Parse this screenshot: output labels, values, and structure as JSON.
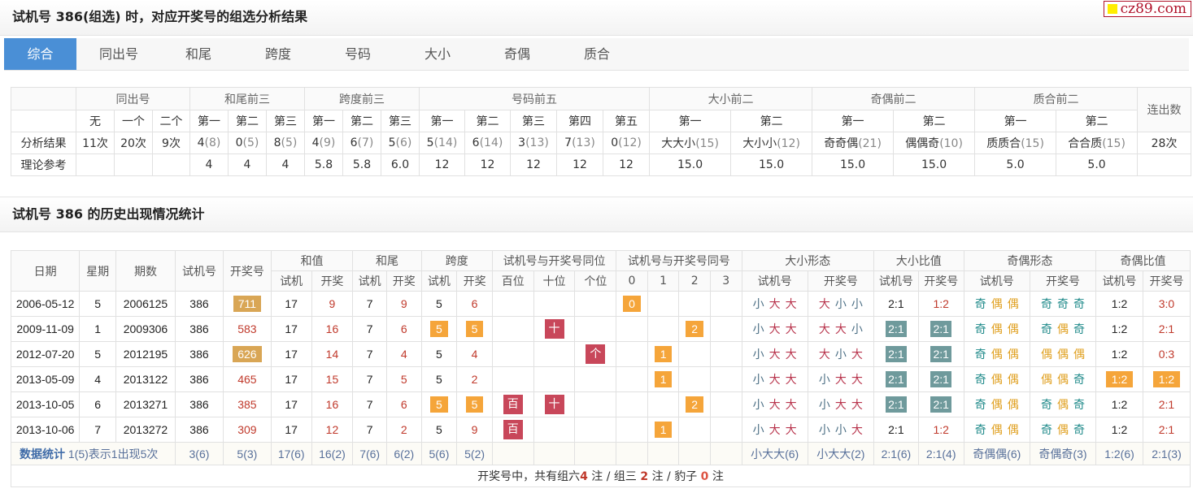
{
  "header": {
    "title": "试机号 386(组选) 时，对应开奖号的组选分析结果",
    "logo_text": "cz89.com"
  },
  "tabs": [
    {
      "label": "综合",
      "active": true
    },
    {
      "label": "同出号"
    },
    {
      "label": "和尾"
    },
    {
      "label": "跨度"
    },
    {
      "label": "号码"
    },
    {
      "label": "大小"
    },
    {
      "label": "奇偶"
    },
    {
      "label": "质合"
    }
  ],
  "analysis": {
    "groups": [
      "同出号",
      "和尾前三",
      "跨度前三",
      "号码前五",
      "大小前二",
      "奇偶前二",
      "质合前二",
      "连出数"
    ],
    "sub_tongchu": [
      "无",
      "一个",
      "二个"
    ],
    "sub_ordinals": [
      "第一",
      "第二",
      "第三",
      "第四",
      "第五"
    ],
    "row_labels": [
      "分析结果",
      "理论参考"
    ],
    "result": {
      "tongchu": [
        "11次",
        "20次",
        "9次"
      ],
      "hewei": [
        {
          "v": "4",
          "c": "(8)"
        },
        {
          "v": "0",
          "c": "(5)"
        },
        {
          "v": "8",
          "c": "(5)"
        }
      ],
      "kuadu": [
        {
          "v": "4",
          "c": "(9)"
        },
        {
          "v": "6",
          "c": "(7)"
        },
        {
          "v": "5",
          "c": "(6)"
        }
      ],
      "haoma": [
        {
          "v": "5",
          "c": "(14)"
        },
        {
          "v": "6",
          "c": "(14)"
        },
        {
          "v": "3",
          "c": "(13)"
        },
        {
          "v": "7",
          "c": "(13)"
        },
        {
          "v": "0",
          "c": "(12)"
        }
      ],
      "daxiao": [
        {
          "v": "大大小",
          "c": "(15)"
        },
        {
          "v": "大小小",
          "c": "(12)"
        }
      ],
      "jiou": [
        {
          "v": "奇奇偶",
          "c": "(21)"
        },
        {
          "v": "偶偶奇",
          "c": "(10)"
        }
      ],
      "zhihe": [
        {
          "v": "质质合",
          "c": "(15)"
        },
        {
          "v": "合合质",
          "c": "(15)"
        }
      ],
      "lianchu": "28次"
    },
    "theory": {
      "hewei": [
        "4",
        "4",
        "4"
      ],
      "kuadu": [
        "5.8",
        "5.8",
        "6.0"
      ],
      "haoma": [
        "12",
        "12",
        "12",
        "12",
        "12"
      ],
      "daxiao": [
        "15.0",
        "15.0"
      ],
      "jiou": [
        "15.0",
        "15.0"
      ],
      "zhihe": [
        "5.0",
        "5.0"
      ]
    }
  },
  "history": {
    "title": "试机号 386 的历史出现情况统计",
    "headers": {
      "date": "日期",
      "week": "星期",
      "issue": "期数",
      "test": "试机号",
      "draw": "开奖号",
      "sum": "和值",
      "sum_tail": "和尾",
      "span": "跨度",
      "same_pos": "试机号与开奖号同位",
      "same_num": "试机号与开奖号同号",
      "bs_form": "大小形态",
      "bs_ratio": "大小比值",
      "oe_form": "奇偶形态",
      "oe_ratio": "奇偶比值",
      "sj": "试机",
      "kj": "开奖",
      "sjh": "试机号",
      "kjh": "开奖号",
      "pos": [
        "百位",
        "十位",
        "个位"
      ],
      "nums": [
        "0",
        "1",
        "2",
        "3"
      ]
    },
    "rows": [
      {
        "date": "2006-05-12",
        "week": "5",
        "issue": "2006125",
        "test": "386",
        "draw": "711",
        "draw_badge": true,
        "sum_t": "17",
        "sum_k": "9",
        "tail_t": "7",
        "tail_k": "9",
        "span_t": "5",
        "span_k": "6",
        "span_hl": false,
        "pos": [
          "",
          "",
          ""
        ],
        "num": [
          "0",
          "",
          "",
          ""
        ],
        "bs_t": [
          [
            "小",
            "s"
          ],
          [
            "大",
            "d"
          ],
          [
            "大",
            "d"
          ]
        ],
        "bs_k": [
          [
            "大",
            "d"
          ],
          [
            "小",
            "s"
          ],
          [
            "小",
            "s"
          ]
        ],
        "bsr_t": "2:1",
        "bsr_k": "1:2",
        "bsr_hl": false,
        "oe_t": [
          [
            "奇",
            "j"
          ],
          [
            "偶",
            "o"
          ],
          [
            "偶",
            "o"
          ]
        ],
        "oe_k": [
          [
            "奇",
            "j"
          ],
          [
            "奇",
            "j"
          ],
          [
            "奇",
            "j"
          ]
        ],
        "oer_t": "1:2",
        "oer_k": "3:0",
        "oer_hl": false
      },
      {
        "date": "2009-11-09",
        "week": "1",
        "issue": "2009306",
        "test": "386",
        "draw": "583",
        "draw_badge": false,
        "sum_t": "17",
        "sum_k": "16",
        "tail_t": "7",
        "tail_k": "6",
        "span_t": "5",
        "span_k": "5",
        "span_hl": true,
        "pos": [
          "",
          "十",
          ""
        ],
        "num": [
          "",
          "",
          "2",
          ""
        ],
        "bs_t": [
          [
            "小",
            "s"
          ],
          [
            "大",
            "d"
          ],
          [
            "大",
            "d"
          ]
        ],
        "bs_k": [
          [
            "大",
            "d"
          ],
          [
            "大",
            "d"
          ],
          [
            "小",
            "s"
          ]
        ],
        "bsr_t": "2:1",
        "bsr_k": "2:1",
        "bsr_hl": true,
        "oe_t": [
          [
            "奇",
            "j"
          ],
          [
            "偶",
            "o"
          ],
          [
            "偶",
            "o"
          ]
        ],
        "oe_k": [
          [
            "奇",
            "j"
          ],
          [
            "偶",
            "o"
          ],
          [
            "奇",
            "j"
          ]
        ],
        "oer_t": "1:2",
        "oer_k": "2:1",
        "oer_hl": false
      },
      {
        "date": "2012-07-20",
        "week": "5",
        "issue": "2012195",
        "test": "386",
        "draw": "626",
        "draw_badge": true,
        "sum_t": "17",
        "sum_k": "14",
        "tail_t": "7",
        "tail_k": "4",
        "span_t": "5",
        "span_k": "4",
        "span_hl": false,
        "pos": [
          "",
          "",
          "个"
        ],
        "num": [
          "",
          "1",
          "",
          ""
        ],
        "bs_t": [
          [
            "小",
            "s"
          ],
          [
            "大",
            "d"
          ],
          [
            "大",
            "d"
          ]
        ],
        "bs_k": [
          [
            "大",
            "d"
          ],
          [
            "小",
            "s"
          ],
          [
            "大",
            "d"
          ]
        ],
        "bsr_t": "2:1",
        "bsr_k": "2:1",
        "bsr_hl": true,
        "oe_t": [
          [
            "奇",
            "j"
          ],
          [
            "偶",
            "o"
          ],
          [
            "偶",
            "o"
          ]
        ],
        "oe_k": [
          [
            "偶",
            "o"
          ],
          [
            "偶",
            "o"
          ],
          [
            "偶",
            "o"
          ]
        ],
        "oer_t": "1:2",
        "oer_k": "0:3",
        "oer_hl": false
      },
      {
        "date": "2013-05-09",
        "week": "4",
        "issue": "2013122",
        "test": "386",
        "draw": "465",
        "draw_badge": false,
        "sum_t": "17",
        "sum_k": "15",
        "tail_t": "7",
        "tail_k": "5",
        "span_t": "5",
        "span_k": "2",
        "span_hl": false,
        "pos": [
          "",
          "",
          ""
        ],
        "num": [
          "",
          "1",
          "",
          ""
        ],
        "bs_t": [
          [
            "小",
            "s"
          ],
          [
            "大",
            "d"
          ],
          [
            "大",
            "d"
          ]
        ],
        "bs_k": [
          [
            "小",
            "s"
          ],
          [
            "大",
            "d"
          ],
          [
            "大",
            "d"
          ]
        ],
        "bsr_t": "2:1",
        "bsr_k": "2:1",
        "bsr_hl": true,
        "oe_t": [
          [
            "奇",
            "j"
          ],
          [
            "偶",
            "o"
          ],
          [
            "偶",
            "o"
          ]
        ],
        "oe_k": [
          [
            "偶",
            "o"
          ],
          [
            "偶",
            "o"
          ],
          [
            "奇",
            "j"
          ]
        ],
        "oer_t": "1:2",
        "oer_k": "1:2",
        "oer_hl": true
      },
      {
        "date": "2013-10-05",
        "week": "6",
        "issue": "2013271",
        "test": "386",
        "draw": "385",
        "draw_badge": false,
        "sum_t": "17",
        "sum_k": "16",
        "tail_t": "7",
        "tail_k": "6",
        "span_t": "5",
        "span_k": "5",
        "span_hl": true,
        "pos": [
          "百",
          "十",
          ""
        ],
        "num": [
          "",
          "",
          "2",
          ""
        ],
        "bs_t": [
          [
            "小",
            "s"
          ],
          [
            "大",
            "d"
          ],
          [
            "大",
            "d"
          ]
        ],
        "bs_k": [
          [
            "小",
            "s"
          ],
          [
            "大",
            "d"
          ],
          [
            "大",
            "d"
          ]
        ],
        "bsr_t": "2:1",
        "bsr_k": "2:1",
        "bsr_hl": true,
        "oe_t": [
          [
            "奇",
            "j"
          ],
          [
            "偶",
            "o"
          ],
          [
            "偶",
            "o"
          ]
        ],
        "oe_k": [
          [
            "奇",
            "j"
          ],
          [
            "偶",
            "o"
          ],
          [
            "奇",
            "j"
          ]
        ],
        "oer_t": "1:2",
        "oer_k": "2:1",
        "oer_hl": false
      },
      {
        "date": "2013-10-06",
        "week": "7",
        "issue": "2013272",
        "test": "386",
        "draw": "309",
        "draw_badge": false,
        "sum_t": "17",
        "sum_k": "12",
        "tail_t": "7",
        "tail_k": "2",
        "span_t": "5",
        "span_k": "9",
        "span_hl": false,
        "pos": [
          "百",
          "",
          ""
        ],
        "num": [
          "",
          "1",
          "",
          ""
        ],
        "bs_t": [
          [
            "小",
            "s"
          ],
          [
            "大",
            "d"
          ],
          [
            "大",
            "d"
          ]
        ],
        "bs_k": [
          [
            "小",
            "s"
          ],
          [
            "小",
            "s"
          ],
          [
            "大",
            "d"
          ]
        ],
        "bsr_t": "2:1",
        "bsr_k": "1:2",
        "bsr_hl": false,
        "oe_t": [
          [
            "奇",
            "j"
          ],
          [
            "偶",
            "o"
          ],
          [
            "偶",
            "o"
          ]
        ],
        "oe_k": [
          [
            "奇",
            "j"
          ],
          [
            "偶",
            "o"
          ],
          [
            "奇",
            "j"
          ]
        ],
        "oer_t": "1:2",
        "oer_k": "2:1",
        "oer_hl": false
      }
    ],
    "stats": {
      "label": "数据统计",
      "note": "1(5)表示1出现5次",
      "test": "3(6)",
      "draw": "5(3)",
      "sum_t": "17(6)",
      "sum_k": "16(2)",
      "tail_t": "7(6)",
      "tail_k": "6(2)",
      "span_t": "5(6)",
      "span_k": "5(2)",
      "bs_t": "小大大(6)",
      "bs_k": "小大大(2)",
      "bsr_t": "2:1(6)",
      "bsr_k": "2:1(4)",
      "oe_t": "奇偶偶(6)",
      "oe_k": "奇偶奇(3)",
      "oer_t": "1:2(6)",
      "oer_k": "2:1(3)"
    },
    "summary": {
      "prefix": "开奖号中，共有组六",
      "zu6": "4",
      "mid1": " 注 / 组三 ",
      "zu3": "2",
      "mid2": " 注 / 豹子 ",
      "baozi": "0",
      "suffix": " 注"
    }
  }
}
